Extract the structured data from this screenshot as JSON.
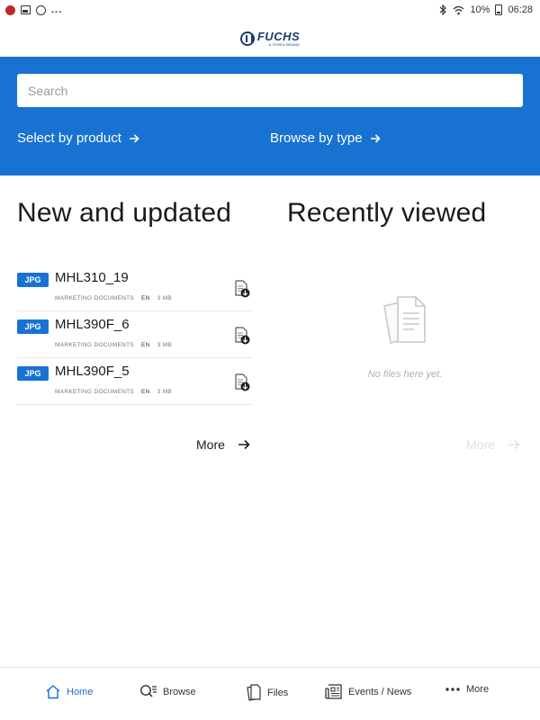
{
  "status_bar": {
    "battery": "10%",
    "time": "06:28",
    "ellipsis": "..."
  },
  "header": {
    "logo_text": "FUCHS",
    "logo_sub": "A TEREX BRAND"
  },
  "search": {
    "placeholder": "Search"
  },
  "hero": {
    "select_by_product": "Select by product",
    "browse_by_type": "Browse by type"
  },
  "new_and_updated": {
    "title": "New and updated",
    "items": [
      {
        "badge": "JPG",
        "name": "MHL310_19",
        "category": "MARKETING DOCUMENTS",
        "lang": "EN",
        "size": "3 MB"
      },
      {
        "badge": "JPG",
        "name": "MHL390F_6",
        "category": "MARKETING DOCUMENTS",
        "lang": "EN",
        "size": "3 MB"
      },
      {
        "badge": "JPG",
        "name": "MHL390F_5",
        "category": "MARKETING DOCUMENTS",
        "lang": "EN",
        "size": "3 MB"
      }
    ],
    "more_label": "More"
  },
  "recently_viewed": {
    "title": "Recently viewed",
    "empty_text": "No files here yet.",
    "more_label": "More"
  },
  "bottom_nav": {
    "items": [
      {
        "label": "Home",
        "icon": "home-icon",
        "active": true
      },
      {
        "label": "Browse",
        "icon": "browse-icon",
        "active": false
      },
      {
        "label": "Files",
        "icon": "files-icon",
        "active": false
      },
      {
        "label": "Events / News",
        "icon": "news-icon",
        "active": false
      },
      {
        "label": "More",
        "icon": "more-dots-icon",
        "active": false
      }
    ]
  },
  "colors": {
    "brand_blue": "#1872d1",
    "logo_navy": "#1c3a6b",
    "disabled_gray": "#e0e0e0"
  }
}
